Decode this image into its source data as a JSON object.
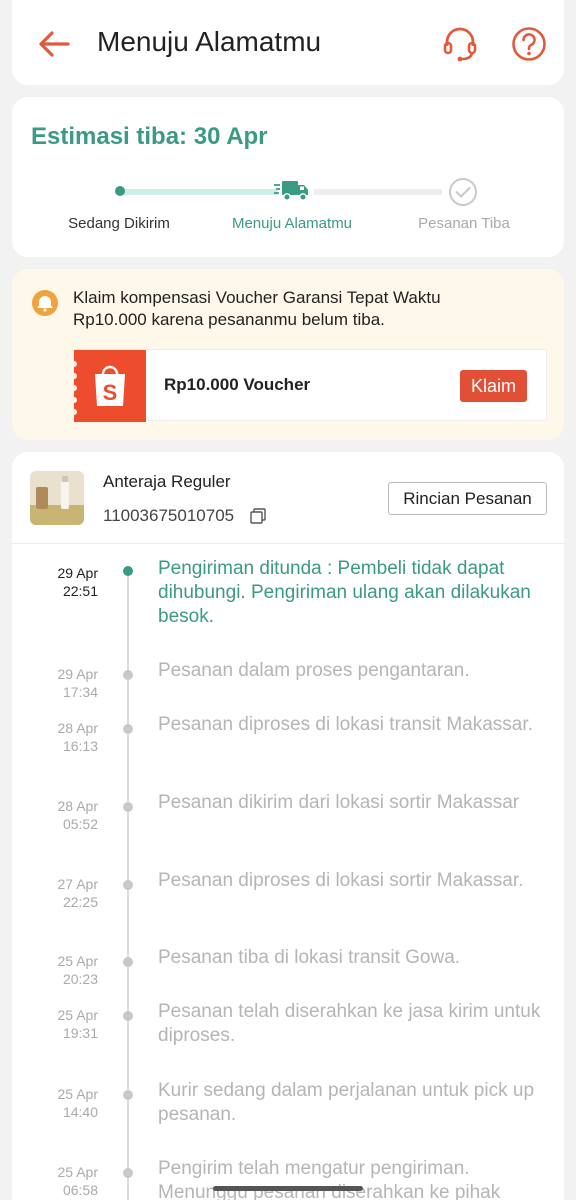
{
  "header": {
    "title": "Menuju Alamatmu",
    "icons": {
      "back": "arrow-left-icon",
      "support": "headset-icon",
      "help": "question-circle-icon"
    },
    "accent_color": "#ee4d2d"
  },
  "estimate": {
    "eta_label": "Estimasi tiba: 30 Apr",
    "steps": [
      "Sedang Dikirim",
      "Menuju Alamatmu",
      "Pesanan Tiba"
    ],
    "current_step": 1,
    "accent_color": "#3b9a84"
  },
  "voucher": {
    "claim_text": "Klaim kompensasi Voucher Garansi Tepat Waktu Rp10.000 karena pesananmu belum tiba.",
    "amount_label": "Rp10.000 Voucher",
    "claim_button": "Klaim",
    "logo_letter": "S"
  },
  "shipment": {
    "courier": "Anteraja Reguler",
    "tracking_number": "11003675010705",
    "detail_button": "Rincian Pesanan",
    "events": [
      {
        "date": "29 Apr",
        "time": "22:51",
        "text": "Pengiriman ditunda : Pembeli tidak dapat dihubungi. Pengiriman ulang akan dilakukan besok.",
        "active": true
      },
      {
        "date": "29 Apr",
        "time": "17:34",
        "text": "Pesanan dalam proses pengantaran."
      },
      {
        "date": "28 Apr",
        "time": "16:13",
        "text": "Pesanan diproses di lokasi transit Makassar."
      },
      {
        "date": "28 Apr",
        "time": "05:52",
        "text": "Pesanan dikirim dari lokasi sortir Makassar"
      },
      {
        "date": "27 Apr",
        "time": "22:25",
        "text": "Pesanan diproses di lokasi sortir Makassar."
      },
      {
        "date": "25 Apr",
        "time": "20:23",
        "text": "Pesanan tiba di lokasi transit  Gowa."
      },
      {
        "date": "25 Apr",
        "time": "19:31",
        "text": "Pesanan telah diserahkan ke jasa kirim untuk diproses."
      },
      {
        "date": "25 Apr",
        "time": "14:40",
        "text": "Kurir sedang dalam perjalanan untuk pick up pesanan."
      },
      {
        "date": "25 Apr",
        "time": "06:58",
        "text": "Pengirim telah mengatur pengiriman. Menunggu pesanan diserahkan ke pihak"
      }
    ]
  }
}
